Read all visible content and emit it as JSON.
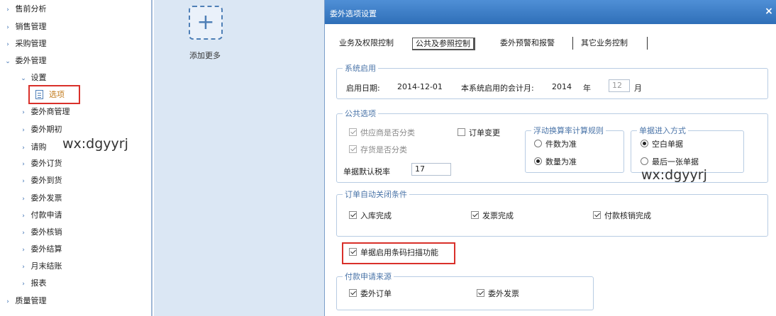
{
  "sidebar": {
    "items": [
      {
        "label": "售前分析",
        "arrow": "›"
      },
      {
        "label": "销售管理",
        "arrow": "›"
      },
      {
        "label": "采购管理",
        "arrow": "›"
      },
      {
        "label": "委外管理",
        "arrow": "⌄"
      },
      {
        "label": "设置",
        "arrow": "⌄"
      },
      {
        "label": "选项"
      },
      {
        "label": "委外商管理",
        "arrow": "›"
      },
      {
        "label": "委外期初",
        "arrow": "›"
      },
      {
        "label": "请购",
        "arrow": "›"
      },
      {
        "label": "委外订货",
        "arrow": "›"
      },
      {
        "label": "委外到货",
        "arrow": "›"
      },
      {
        "label": "委外发票",
        "arrow": "›"
      },
      {
        "label": "付款申请",
        "arrow": "›"
      },
      {
        "label": "委外核销",
        "arrow": "›"
      },
      {
        "label": "委外结算",
        "arrow": "›"
      },
      {
        "label": "月末结账",
        "arrow": "›"
      },
      {
        "label": "报表",
        "arrow": "›"
      },
      {
        "label": "质量管理",
        "arrow": "›"
      }
    ]
  },
  "watermarks": [
    "wx:dgyyrj",
    "wx:dgyyrj"
  ],
  "workspace": {
    "add_icon": "+",
    "add_label": "添加更多"
  },
  "dialog": {
    "title": "委外选项设置",
    "close": "×",
    "tabs": [
      "业务及权限控制",
      "公共及参照控制",
      "委外预警和报警",
      "其它业务控制"
    ],
    "system_start": {
      "legend": "系统启用",
      "date_label": "启用日期:",
      "date_value": "2014-12-01",
      "period_label": "本系统启用的会计月:",
      "year_value": "2014",
      "year_unit": "年",
      "month_value": "12",
      "month_unit": "月"
    },
    "common": {
      "legend": "公共选项",
      "supplier_classified": "供应商是否分类",
      "inventory_classified": "存货是否分类",
      "order_change": "订单变更",
      "tax_rate_label": "单据默认税率",
      "tax_rate_value": "17",
      "float_rate": {
        "legend": "浮动换算率计算规则",
        "option1": "件数为准",
        "option2": "数量为准"
      },
      "entry_mode": {
        "legend": "单据进入方式",
        "option1": "空白单据",
        "option2": "最后一张单据"
      }
    },
    "auto_close": {
      "legend": "订单自动关闭条件",
      "opt1": "入库完成",
      "opt2": "发票完成",
      "opt3": "付款核销完成"
    },
    "barcode_scan": "单据启用条码扫描功能",
    "payment_source": {
      "legend": "付款申请来源",
      "opt1": "委外订单",
      "opt2": "委外发票"
    }
  }
}
